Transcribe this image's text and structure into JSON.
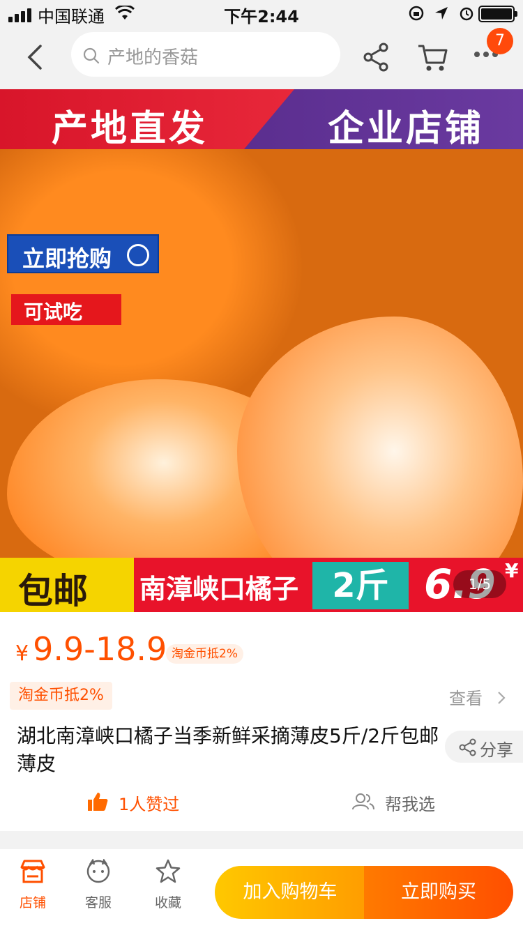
{
  "status_bar": {
    "carrier": "中国联通",
    "time": "下午2:44"
  },
  "nav": {
    "search_placeholder": "产地的香菇",
    "cart_badge": "7"
  },
  "hero": {
    "banner_left": "产地直发",
    "banner_right": "企业店铺",
    "buy_now_tag": "立即抢购",
    "try_tag": "可试吃",
    "bottom_left": "包邮",
    "bottom_name": "南漳峡口橘子",
    "bottom_weight": "2斤",
    "bottom_price": "6.9",
    "bottom_currency": "¥",
    "page_indicator": "1/5"
  },
  "product": {
    "currency": "¥",
    "price_range": "9.9-18.9",
    "price_tag": "淘金币抵2%",
    "coin_tag": "淘金币抵2%",
    "view_label": "查看",
    "title": "湖北南漳峡口橘子当季新鲜采摘薄皮5斤/2斤包邮薄皮",
    "share_label": "分享",
    "likes_label": "1人赞过",
    "help_choose_label": "帮我选"
  },
  "bottom_bar": {
    "store_label": "店铺",
    "service_label": "客服",
    "favorite_label": "收藏",
    "add_to_cart_label": "加入购物车",
    "buy_now_label": "立即购买"
  },
  "colors": {
    "accent": "#ff5000",
    "cart_gradient_start": "#ffc800",
    "buy_gradient_end": "#ff4f00"
  }
}
